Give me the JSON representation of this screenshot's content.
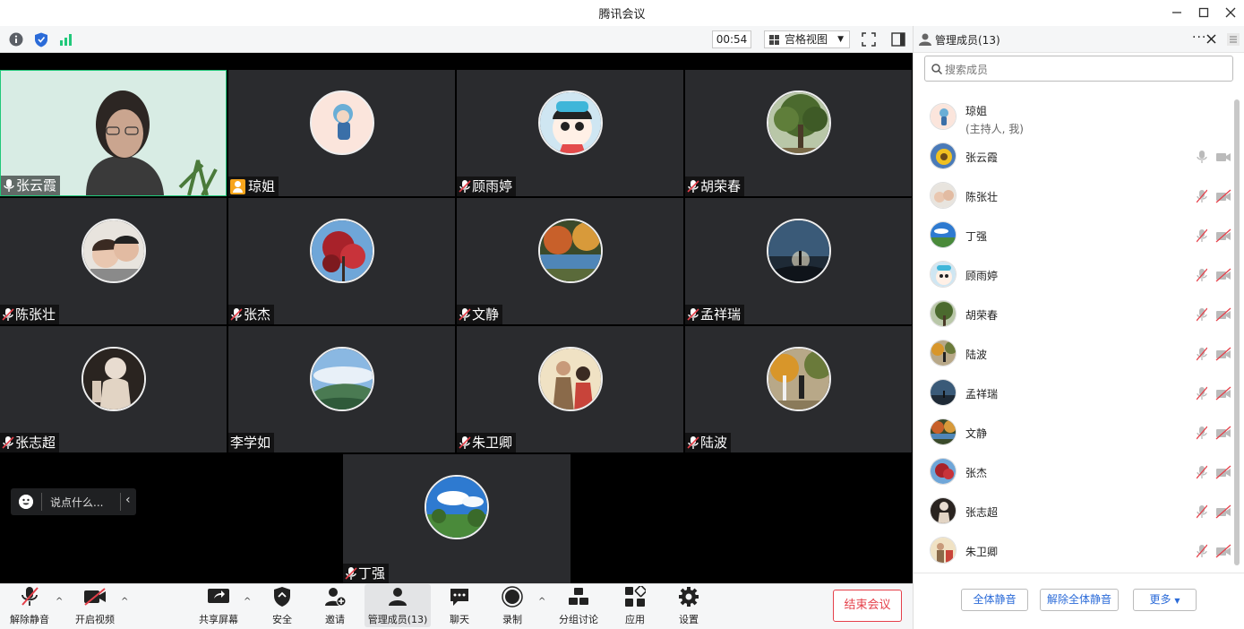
{
  "window": {
    "title": "腾讯会议"
  },
  "toolbar": {
    "timer": "00:54",
    "view_label": "宫格视图"
  },
  "tiles": [
    {
      "name": "张云霞",
      "mic": "on"
    },
    {
      "name": "琼姐",
      "mic": "host"
    },
    {
      "name": "顾雨婷",
      "mic": "off"
    },
    {
      "name": "胡荣春",
      "mic": "off"
    },
    {
      "name": "陈张壮",
      "mic": "off"
    },
    {
      "name": "张杰",
      "mic": "off"
    },
    {
      "name": "文静",
      "mic": "off"
    },
    {
      "name": "孟祥瑞",
      "mic": "off"
    },
    {
      "name": "张志超",
      "mic": "off"
    },
    {
      "name": "李学如",
      "mic": "none"
    },
    {
      "name": "朱卫卿",
      "mic": "off"
    },
    {
      "name": "陆波",
      "mic": "off"
    },
    {
      "name": "丁强",
      "mic": "off"
    }
  ],
  "chat": {
    "placeholder": "说点什么..."
  },
  "bottombar": {
    "unmute": "解除静音",
    "video": "开启视频",
    "share": "共享屏幕",
    "security": "安全",
    "invite": "邀请",
    "members": "管理成员(13)",
    "chat": "聊天",
    "record": "录制",
    "breakout": "分组讨论",
    "apps": "应用",
    "settings": "设置",
    "end": "结束会议"
  },
  "panel": {
    "title": "管理成员(13)",
    "search_placeholder": "搜索成员",
    "members": [
      {
        "name": "琼姐",
        "sub": "(主持人, 我)"
      },
      {
        "name": "张云霞",
        "mic": "on"
      },
      {
        "name": "陈张壮",
        "mic": "off"
      },
      {
        "name": "丁强",
        "mic": "off"
      },
      {
        "name": "顾雨婷",
        "mic": "off"
      },
      {
        "name": "胡荣春",
        "mic": "off"
      },
      {
        "name": "陆波",
        "mic": "off"
      },
      {
        "name": "孟祥瑞",
        "mic": "off"
      },
      {
        "name": "文静",
        "mic": "off"
      },
      {
        "name": "张杰",
        "mic": "off"
      },
      {
        "name": "张志超",
        "mic": "off"
      },
      {
        "name": "朱卫卿",
        "mic": "off"
      }
    ],
    "mute_all": "全体静音",
    "unmute_all": "解除全体静音",
    "more": "更多"
  },
  "colors": {
    "accent_blue": "#2b6bd8",
    "end_red": "#e5404a",
    "active_green": "#21c87a",
    "host_orange": "#f7a51c"
  }
}
